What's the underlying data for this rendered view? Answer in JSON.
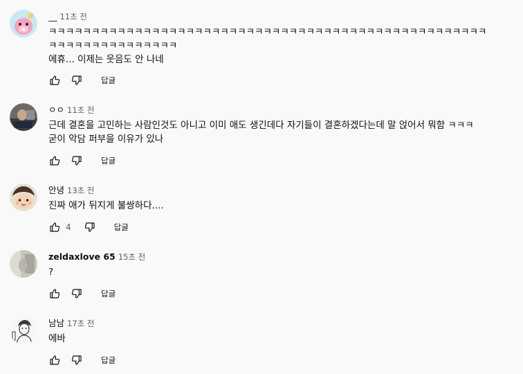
{
  "comments": [
    {
      "author": "__",
      "time": "11초 전",
      "lines": [
        "ㅋㅋㅋㅋㅋㅋㅋㅋㅋㅋㅋㅋㅋㅋㅋㅋㅋㅋㅋㅋㅋㅋㅋㅋㅋㅋㅋㅋㅋㅋㅋㅋㅋㅋㅋㅋㅋㅋㅋㅋㅋㅋㅋㅋㅋㅋㅋㅋㅋㅋㅋ",
        "ㅋㅋㅋㅋㅋㅋㅋㅋㅋㅋㅋㅋㅋㅋㅋ",
        "에휴... 이제는 웃음도 안 나네"
      ],
      "likes": "",
      "reply_label": "답글"
    },
    {
      "author": "ㅇㅇ",
      "time": "11초 전",
      "lines": [
        "근데 결혼을 고민하는 사람인것도 아니고 이미 애도 생긴데다 자기들이 결혼하겠다는데 말 얹어서 뭐함 ㅋㅋㅋ",
        "굳이 악담 퍼부을 이유가 있나"
      ],
      "likes": "",
      "reply_label": "답글"
    },
    {
      "author": "안녕",
      "time": "13초 전",
      "lines": [
        "진짜 애가 뒤지게 불쌍하다...."
      ],
      "likes": "4",
      "reply_label": "답글"
    },
    {
      "author": "zeldaxlove 65",
      "time": "15초 전",
      "lines": [
        "?"
      ],
      "likes": "",
      "reply_label": "답글"
    },
    {
      "author": "남남",
      "time": "17초 전",
      "lines": [
        "에바"
      ],
      "likes": "",
      "reply_label": "답글"
    }
  ],
  "colors": {
    "background": "#f9f9f9",
    "text": "#0f0f0f",
    "secondary_text": "#606060"
  },
  "icons": {
    "like": "thumb-up-outline",
    "dislike": "thumb-down-outline"
  }
}
